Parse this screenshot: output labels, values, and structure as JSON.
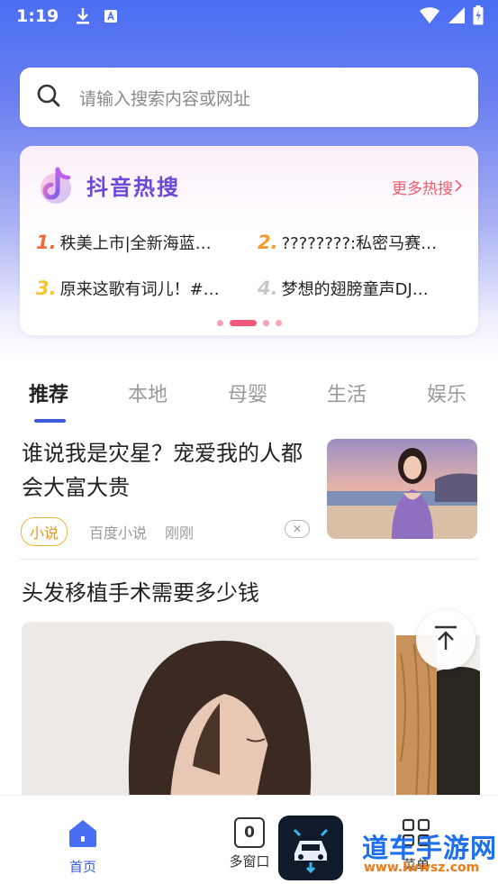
{
  "status_bar": {
    "time": "1:19"
  },
  "search": {
    "placeholder": "请输入搜索内容或网址"
  },
  "hot_search": {
    "title": "抖音热搜",
    "more_label": "更多热搜",
    "items": [
      {
        "rank": "1.",
        "text": "秩美上市|全新海蓝…",
        "color": "#f26b3a"
      },
      {
        "rank": "2.",
        "text": "????????:私密马赛…",
        "color": "#f59a2a"
      },
      {
        "rank": "3.",
        "text": "原来这歌有词儿！#…",
        "color": "#f5c531"
      },
      {
        "rank": "4.",
        "text": "梦想的翅膀童声DJ…",
        "color": "#c8c8c8"
      }
    ],
    "page_count": 4,
    "active_page": 1
  },
  "tabs": [
    "推荐",
    "本地",
    "母婴",
    "生活",
    "娱乐"
  ],
  "feed": {
    "item1": {
      "title": "谁说我是灾星？宠爱我的人都会大富大贵",
      "tag": "小说",
      "source": "百度小说",
      "time": "刚刚"
    },
    "item2": {
      "title": "头发移植手术需要多少钱"
    }
  },
  "bottom_nav": {
    "home": "首页",
    "windows": "多窗口",
    "windows_count": "0",
    "menu": "菜单"
  },
  "watermark": {
    "name": "道车手游网",
    "url": "www.lwwsz.com"
  },
  "colors": {
    "accent": "#3b5bdb",
    "hot_title": "#6c47d9",
    "more": "#f05a6b"
  }
}
